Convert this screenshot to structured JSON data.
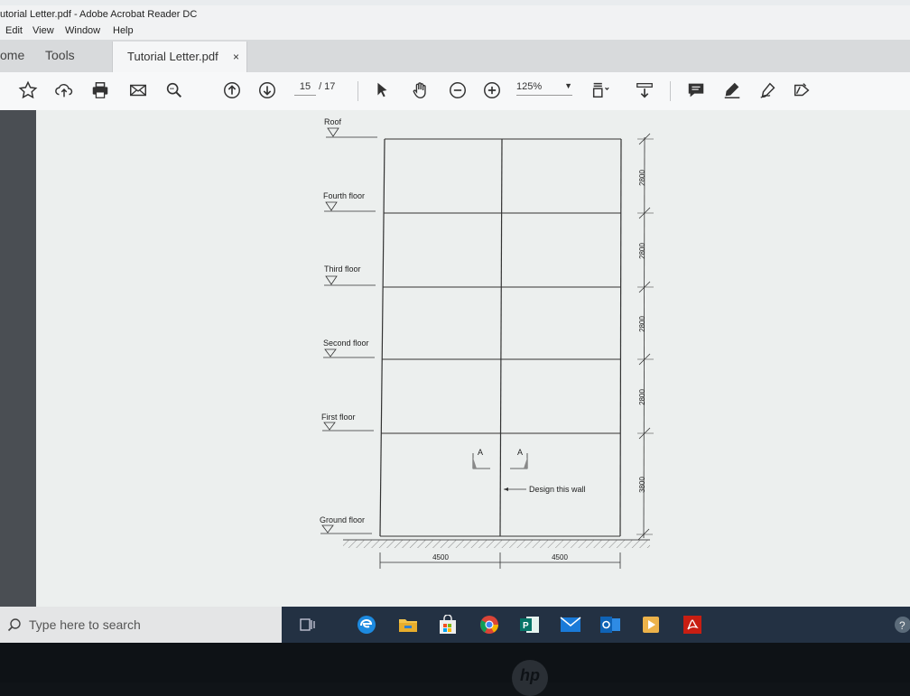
{
  "window": {
    "title": "utorial Letter.pdf - Adobe Acrobat Reader DC"
  },
  "menu": {
    "items": [
      "Edit",
      "View",
      "Window",
      "Help"
    ]
  },
  "tabs": {
    "home": "ome",
    "tools": "Tools",
    "document": "Tutorial Letter.pdf",
    "close": "×"
  },
  "toolbar": {
    "page_current": "15",
    "page_total": "/ 17",
    "zoom": "125%",
    "icons": [
      "star-icon",
      "upload-icon",
      "print-icon",
      "email-icon",
      "search-icon",
      "prev-page-icon",
      "next-page-icon",
      "select-icon",
      "hand-icon",
      "zoom-out-icon",
      "zoom-in-icon",
      "page-layout-icon",
      "scroll-icon",
      "comment-icon",
      "highlight-icon",
      "sign-icon",
      "fill-sign-icon"
    ]
  },
  "drawing": {
    "levels": [
      "Roof",
      "Fourth floor",
      "Third floor",
      "Second floor",
      "First floor",
      "Ground floor"
    ],
    "heights": [
      "2800",
      "2800",
      "2800",
      "2800",
      "3800"
    ],
    "spans": [
      "4500",
      "4500"
    ],
    "section_mark": "A",
    "annotation": "Design this wall"
  },
  "taskbar": {
    "search_placeholder": "Type here to search",
    "apps": [
      "task-view-icon",
      "edge-icon",
      "file-explorer-icon",
      "store-icon",
      "chrome-icon",
      "publisher-icon",
      "mail-icon",
      "outlook-icon",
      "media-player-icon",
      "acrobat-icon"
    ]
  },
  "brand": {
    "logo": "hp"
  }
}
